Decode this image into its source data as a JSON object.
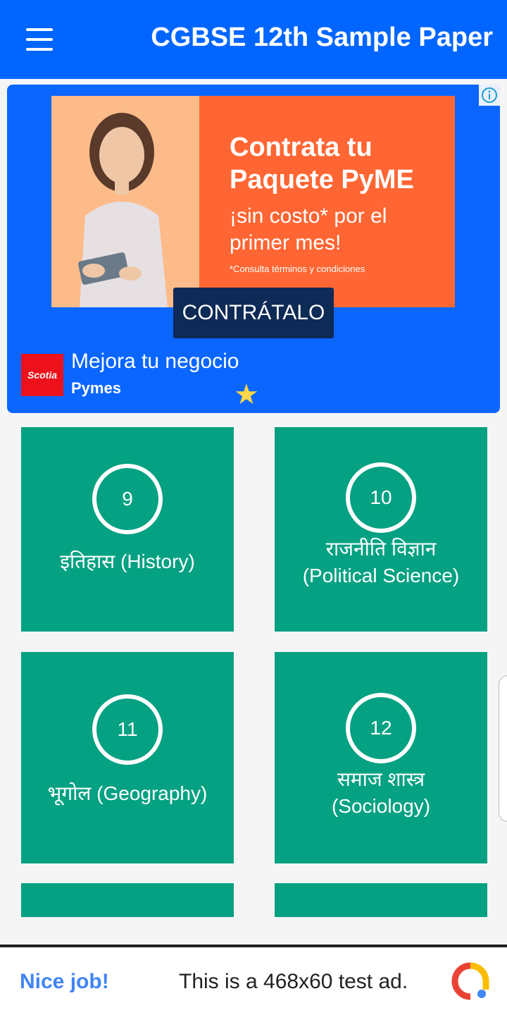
{
  "appbar": {
    "title": "CGBSE 12th Sample Paper",
    "color": "#0066ff"
  },
  "top_ad": {
    "headline": "Contrata tu Paquete PyME",
    "subline": "¡sin costo* por el primer mes!",
    "disclaimer": "*Consulta términos y condiciones",
    "cta": "CONTRÁTALO",
    "logo_text": "Scotia",
    "title": "Mejora tu negocio",
    "subtitle": "Pymes"
  },
  "cards": [
    {
      "number": "9",
      "label": "इतिहास (History)"
    },
    {
      "number": "10",
      "label": "राजनीति विज्ञान (Political Science)"
    },
    {
      "number": "11",
      "label": "भूगोल (Geography)"
    },
    {
      "number": "12",
      "label": "समाज शास्त्र (Sociology)"
    }
  ],
  "card_color": "#04a182",
  "bottom_ad": {
    "nice": "Nice job!",
    "text": "This is a 468x60 test ad."
  }
}
